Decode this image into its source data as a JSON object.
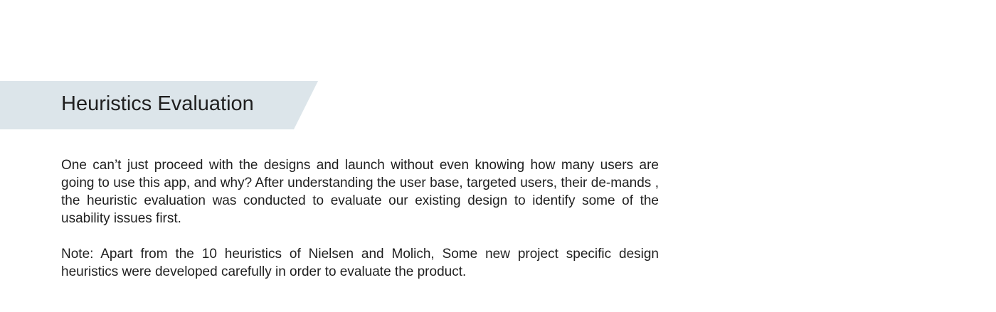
{
  "header": {
    "title": "Heuristics Evaluation",
    "band_color": "#dce5ea"
  },
  "content": {
    "paragraphs": [
      "One can’t just proceed with the designs and launch without even knowing how many users are going to use this app, and why? After understanding the user base, targeted users, their de-mands , the heuristic evaluation was conducted to evaluate our existing design to identify some of the usability issues first.",
      "Note: Apart from the 10 heuristics of Nielsen and Molich, Some new project specific design heuristics were developed carefully in order to evaluate the product."
    ]
  }
}
